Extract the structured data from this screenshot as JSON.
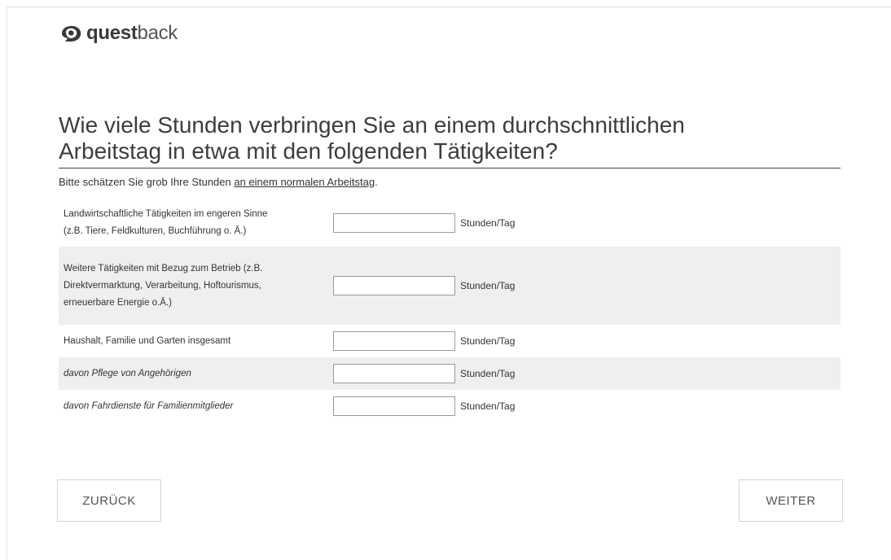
{
  "brand": {
    "bold": "quest",
    "light": "back"
  },
  "question": {
    "line1": "Wie viele Stunden verbringen Sie an einem durchschnittlichen",
    "line2": "Arbeitstag in etwa mit den folgenden Tätigkeiten?"
  },
  "instruction": {
    "prefix": "Bitte schätzen Sie grob Ihre Stunden ",
    "underlined": "an einem normalen Arbeitstag",
    "suffix": "."
  },
  "rows": [
    {
      "line1": "Landwirtschaftliche Tätigkeiten im engeren Sinne",
      "line2": "(z.B. Tiere, Feldkulturen, Buchführung o. Ä.)",
      "line3": "",
      "value": "",
      "unit": "Stunden/Tag"
    },
    {
      "line1": "Weitere Tätigkeiten mit Bezug zum Betrieb (z.B.",
      "line2": "Direktvermarktung, Verarbeitung, Hoftourismus,",
      "line3": "erneuerbare Energie o.Ä.)",
      "value": "",
      "unit": "Stunden/Tag"
    },
    {
      "line1": "Haushalt, Familie und Garten insgesamt",
      "line2": "",
      "line3": "",
      "value": "",
      "unit": "Stunden/Tag"
    },
    {
      "line1": "davon Pflege von Angehörigen",
      "line2": "",
      "line3": "",
      "value": "",
      "unit": "Stunden/Tag"
    },
    {
      "line1": "davon Fahrdienste für Familienmitglieder",
      "line2": "",
      "line3": "",
      "value": "",
      "unit": "Stunden/Tag"
    }
  ],
  "buttons": {
    "back": "ZURÜCK",
    "next": "WEITER"
  },
  "colors": {
    "text": "#333333",
    "row_shade": "#efefef",
    "border": "#d3d3d3"
  }
}
